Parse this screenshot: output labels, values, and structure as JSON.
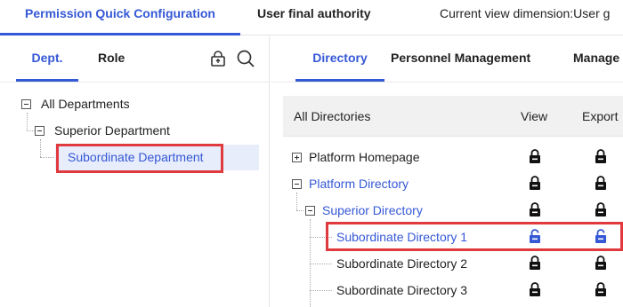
{
  "top_tabs": {
    "quick_config": "Permission Quick Configuration",
    "final_authority": "User final authority",
    "view_dimension": "Current view dimension:User g"
  },
  "left": {
    "tabs": {
      "dept": "Dept.",
      "role": "Role"
    },
    "tools": [
      "lock-icon",
      "search-icon"
    ],
    "tree": {
      "all": "All Departments",
      "superior": "Superior Department",
      "subordinate": "Subordinate Department"
    }
  },
  "right": {
    "tabs": {
      "directory": "Directory",
      "personnel": "Personnel Management",
      "manage": "Manage"
    },
    "headers": {
      "name": "All Directories",
      "view": "View",
      "export": "Export"
    },
    "rows": [
      {
        "label": "Platform Homepage",
        "view": "locked",
        "export": "locked"
      },
      {
        "label": "Platform Directory",
        "view": "locked",
        "export": "locked"
      },
      {
        "label": "Superior Directory",
        "view": "locked",
        "export": "locked"
      },
      {
        "label": "Subordinate Directory 1",
        "view": "unlocked",
        "export": "unlocked"
      },
      {
        "label": "Subordinate Directory 2",
        "view": "locked",
        "export": "locked"
      },
      {
        "label": "Subordinate Directory 3",
        "view": "locked",
        "export": "locked"
      }
    ]
  },
  "colors": {
    "accent": "#3558d6",
    "highlight": "#e0393e",
    "selected_bg": "#e8edfb",
    "lock": "#111111"
  }
}
